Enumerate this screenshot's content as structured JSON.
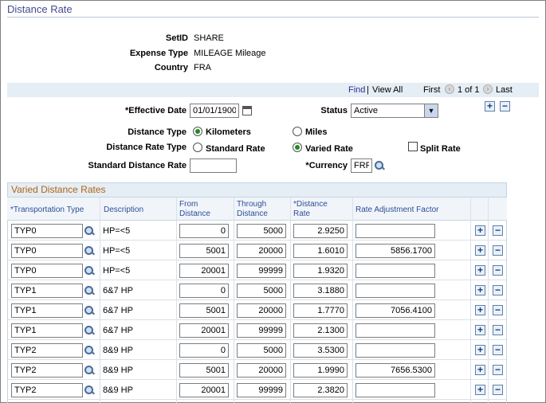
{
  "page": {
    "title": "Distance Rate"
  },
  "header": {
    "setid_label": "SetID",
    "setid": "SHARE",
    "expense_type_label": "Expense Type",
    "expense_type": "MILEAGE",
    "expense_type_desc": "Mileage",
    "country_label": "Country",
    "country": "FRA"
  },
  "nav": {
    "find": "Find",
    "separator": "|",
    "view_all": "View All",
    "first": "First",
    "counter": "1 of 1",
    "last": "Last"
  },
  "form": {
    "effective_date_label": "*Effective Date",
    "effective_date": "01/01/1900",
    "status_label": "Status",
    "status": "Active",
    "distance_type_label": "Distance Type",
    "kilometers": "Kilometers",
    "miles": "Miles",
    "distance_rate_type_label": "Distance Rate Type",
    "standard_rate": "Standard Rate",
    "varied_rate": "Varied Rate",
    "split_rate": "Split Rate",
    "standard_distance_rate_label": "Standard Distance Rate",
    "standard_distance_rate": "",
    "currency_label": "*Currency",
    "currency": "FRF"
  },
  "grid": {
    "title": "Varied Distance Rates",
    "headers": {
      "transport": "*Transportation Type",
      "description": "Description",
      "from1": "From",
      "from2": "Distance",
      "through1": "Through",
      "through2": "Distance",
      "rate1": "*Distance",
      "rate2": "Rate",
      "adj": "Rate Adjustment Factor"
    },
    "rows": [
      {
        "type": "TYP0",
        "desc": "HP=<5",
        "from": "0",
        "through": "5000",
        "rate": "2.9250",
        "adj": ""
      },
      {
        "type": "TYP0",
        "desc": "HP=<5",
        "from": "5001",
        "through": "20000",
        "rate": "1.6010",
        "adj": "5856.1700"
      },
      {
        "type": "TYP0",
        "desc": "HP=<5",
        "from": "20001",
        "through": "99999",
        "rate": "1.9320",
        "adj": ""
      },
      {
        "type": "TYP1",
        "desc": "6&7 HP",
        "from": "0",
        "through": "5000",
        "rate": "3.1880",
        "adj": ""
      },
      {
        "type": "TYP1",
        "desc": "6&7 HP",
        "from": "5001",
        "through": "20000",
        "rate": "1.7770",
        "adj": "7056.4100"
      },
      {
        "type": "TYP1",
        "desc": "6&7 HP",
        "from": "20001",
        "through": "99999",
        "rate": "2.1300",
        "adj": ""
      },
      {
        "type": "TYP2",
        "desc": "8&9 HP",
        "from": "0",
        "through": "5000",
        "rate": "3.5300",
        "adj": ""
      },
      {
        "type": "TYP2",
        "desc": "8&9 HP",
        "from": "5001",
        "through": "20000",
        "rate": "1.9990",
        "adj": "7656.5300"
      },
      {
        "type": "TYP2",
        "desc": "8&9 HP",
        "from": "20001",
        "through": "99999",
        "rate": "2.3820",
        "adj": ""
      }
    ]
  },
  "icons": {
    "lookup": "magnifier-icon",
    "calendar": "calendar-icon",
    "add": "+",
    "remove": "−",
    "prev": "‹",
    "next": "›",
    "dropdown": "▼"
  }
}
